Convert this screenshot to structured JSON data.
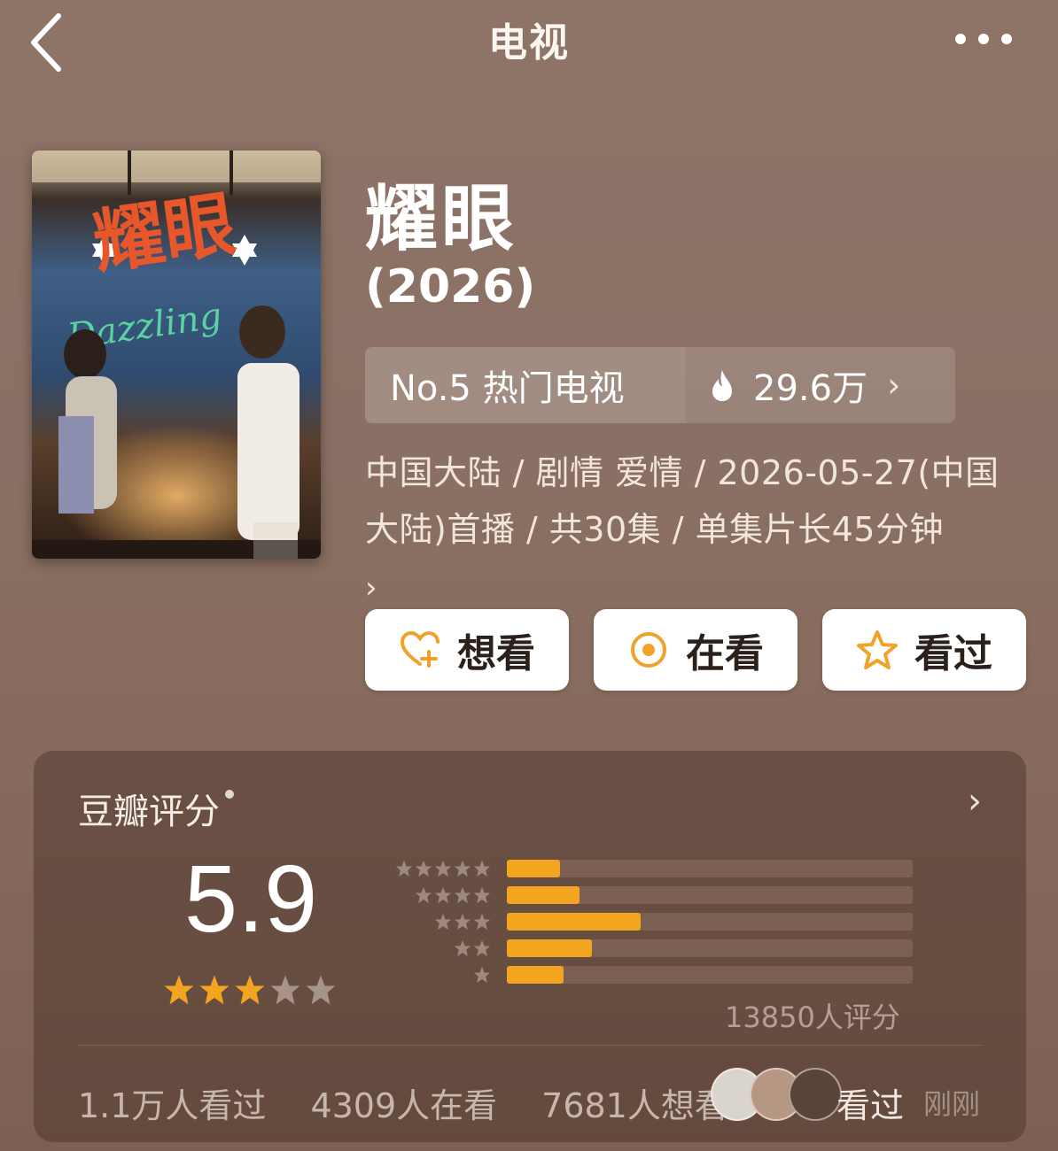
{
  "header": {
    "title": "电视",
    "back_icon": "chevron-left-icon",
    "more_icon": "more-horizontal-icon"
  },
  "poster": {
    "title_art": "耀眼",
    "english_art": "Dazzling"
  },
  "show": {
    "title": "耀眼",
    "year": "(2026)",
    "rank_label": "No.5 热门电视",
    "heat": "29.6万",
    "meta_line": "中国大陆 / 剧情 爱情 / 2026-05-27(中国大陆)首播 / 共30集 / 单集片长45分钟",
    "meta_more": "›"
  },
  "actions": {
    "want": "想看",
    "watching": "在看",
    "watched": "看过"
  },
  "rating": {
    "title": "豆瓣评分",
    "score": "5.9",
    "score_stars": 3,
    "count_label": "13850人评分",
    "distribution": [
      {
        "stars": 5,
        "fraction": 0.13
      },
      {
        "stars": 4,
        "fraction": 0.18
      },
      {
        "stars": 3,
        "fraction": 0.33
      },
      {
        "stars": 2,
        "fraction": 0.21
      },
      {
        "stars": 1,
        "fraction": 0.14
      }
    ],
    "stats": {
      "watched": "1.1万人看过",
      "watching": "4309人在看",
      "want": "7681人想看"
    },
    "recent_label": "看过",
    "recent_time": "刚刚"
  },
  "colors": {
    "accent_orange": "#f4a51f",
    "button_icon": "#f0a32b",
    "background": "#8a7064"
  }
}
